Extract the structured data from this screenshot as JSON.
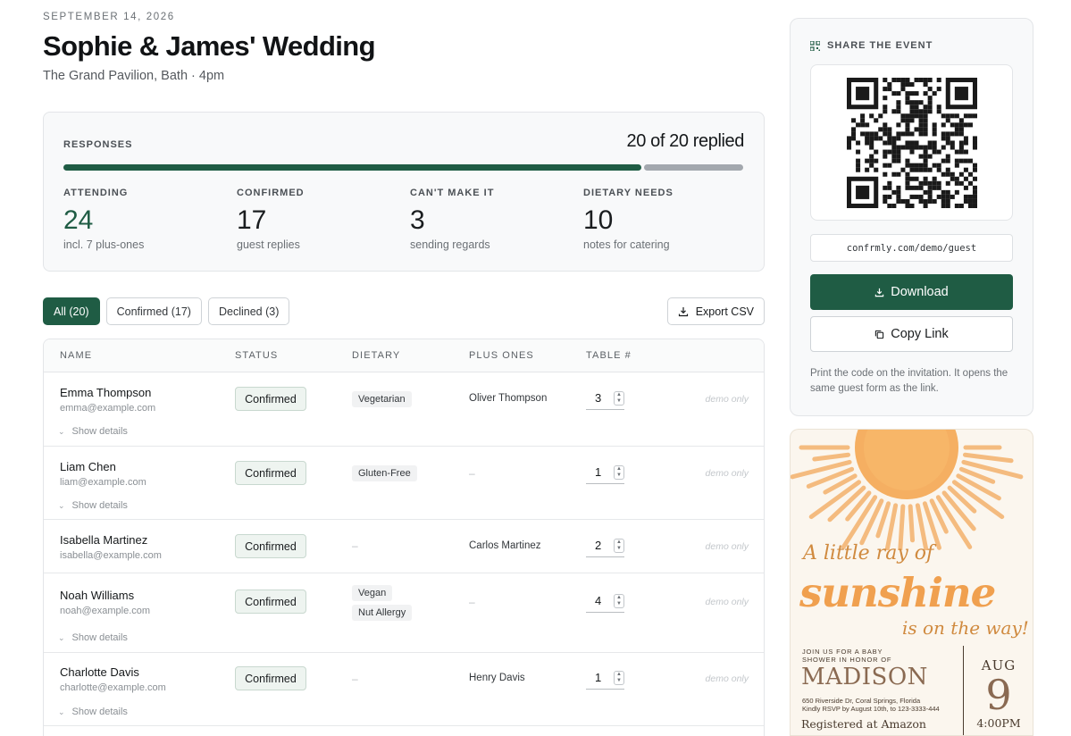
{
  "event": {
    "date": "SEPTEMBER 14, 2026",
    "title": "Sophie & James' Wedding",
    "venue": "The Grand Pavilion, Bath · 4pm"
  },
  "responses": {
    "label": "RESPONSES",
    "count_text": "20 of 20 replied",
    "progress_fraction": 0.85,
    "stats": [
      {
        "label": "ATTENDING",
        "value": "24",
        "sub": "incl. 7 plus-ones"
      },
      {
        "label": "CONFIRMED",
        "value": "17",
        "sub": "guest replies"
      },
      {
        "label": "CAN'T MAKE IT",
        "value": "3",
        "sub": "sending regards"
      },
      {
        "label": "DIETARY NEEDS",
        "value": "10",
        "sub": "notes for catering"
      }
    ]
  },
  "filters": {
    "all": "All (20)",
    "confirmed": "Confirmed (17)",
    "declined": "Declined (3)",
    "export": "Export CSV"
  },
  "table": {
    "headers": [
      "NAME",
      "STATUS",
      "DIETARY",
      "PLUS ONES",
      "TABLE #"
    ],
    "demo_label": "demo only",
    "details_label": "Show details",
    "dash": "–",
    "rows": [
      {
        "name": "Emma Thompson",
        "email": "emma@example.com",
        "status": "Confirmed",
        "dietary": [
          "Vegetarian"
        ],
        "plus_one": "Oliver Thompson",
        "table": "3"
      },
      {
        "name": "Liam Chen",
        "email": "liam@example.com",
        "status": "Confirmed",
        "dietary": [
          "Gluten-Free"
        ],
        "plus_one": "",
        "table": "1"
      },
      {
        "name": "Isabella Martinez",
        "email": "isabella@example.com",
        "status": "Confirmed",
        "dietary": [],
        "plus_one": "Carlos Martinez",
        "table": "2"
      },
      {
        "name": "Noah Williams",
        "email": "noah@example.com",
        "status": "Confirmed",
        "dietary": [
          "Vegan",
          "Nut Allergy"
        ],
        "plus_one": "",
        "table": "4"
      },
      {
        "name": "Charlotte Davis",
        "email": "charlotte@example.com",
        "status": "Confirmed",
        "dietary": [],
        "plus_one": "Henry Davis",
        "table": "1"
      }
    ]
  },
  "share": {
    "heading": "SHARE THE EVENT",
    "url": "confrmly.com/demo/guest",
    "download": "Download",
    "copy": "Copy Link",
    "hint": "Print the code on the invitation. It opens the same guest form as the link."
  },
  "invitation": {
    "line1": "A little ray of",
    "line2": "sunshine",
    "line3": "is on the way!",
    "join": "JOIN US FOR A BABY SHOWER IN HONOR OF",
    "honoree": "MADISON",
    "address": "650 Riverside Dr, Coral Springs, Florida",
    "rsvp": "Kindly RSVP by August 10th, to  123-3333-444",
    "registry": "Registered at Amazon",
    "month": "AUG",
    "day": "9",
    "time": "4:00PM"
  },
  "colors": {
    "accent": "#1f5c44",
    "progress_rest": "#a3a8ae",
    "sun": "#f0a04f"
  },
  "icons": {
    "export": "download-icon",
    "download": "download-icon",
    "copy": "copy-icon",
    "share": "qr-icon",
    "spinner": "updown-icon",
    "details": "chevron-down-icon"
  }
}
